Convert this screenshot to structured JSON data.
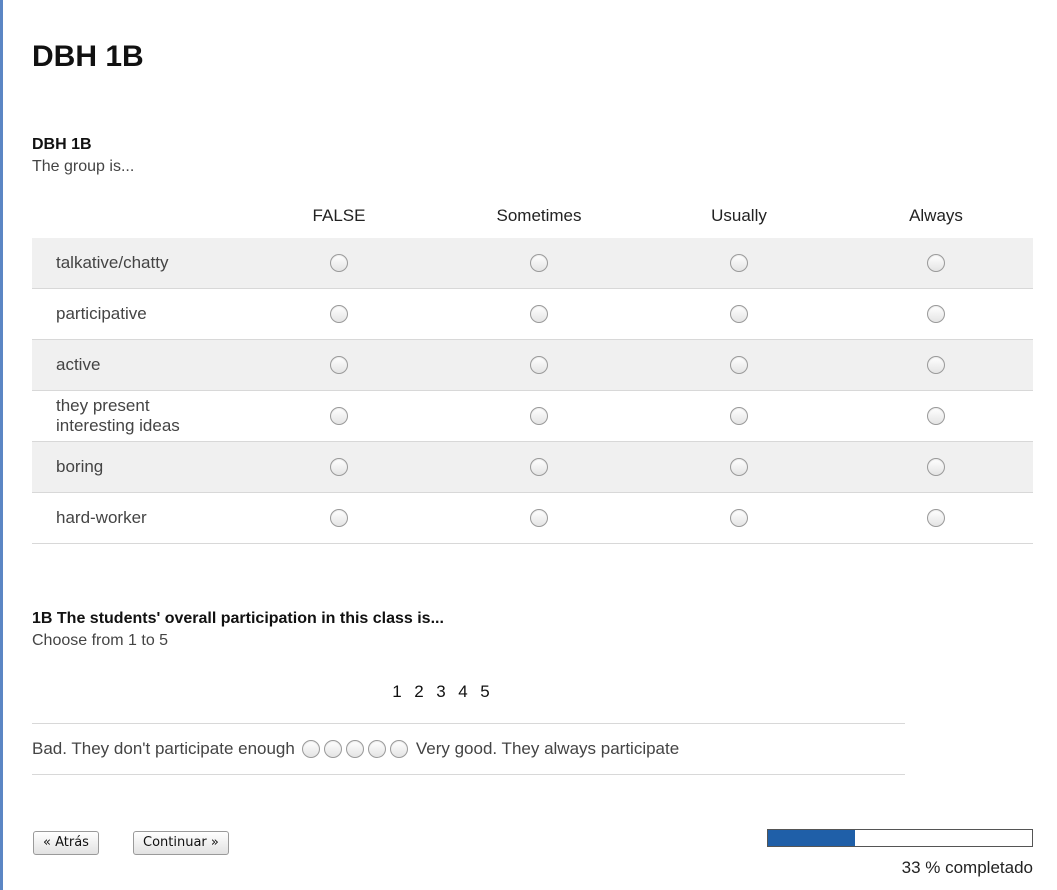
{
  "page": {
    "title": "DBH 1B"
  },
  "question1": {
    "title": "DBH 1B",
    "description": "The group is...",
    "columns": [
      "FALSE",
      "Sometimes",
      "Usually",
      "Always"
    ],
    "rows": [
      "talkative/chatty",
      "participative",
      "active",
      "they present interesting ideas",
      "boring",
      "hard-worker"
    ]
  },
  "question2": {
    "title": "1B The students' overall participation in this class is...",
    "description": "Choose from 1 to 5",
    "scale": [
      "1",
      "2",
      "3",
      "4",
      "5"
    ],
    "left_label": "Bad. They don't participate enough",
    "right_label": "Very good. They always participate"
  },
  "navigation": {
    "back_label": "« Atrás",
    "next_label": "Continuar »"
  },
  "progress": {
    "percent": 33,
    "label": "33 % completado",
    "bar_color": "#1f5fa8"
  }
}
